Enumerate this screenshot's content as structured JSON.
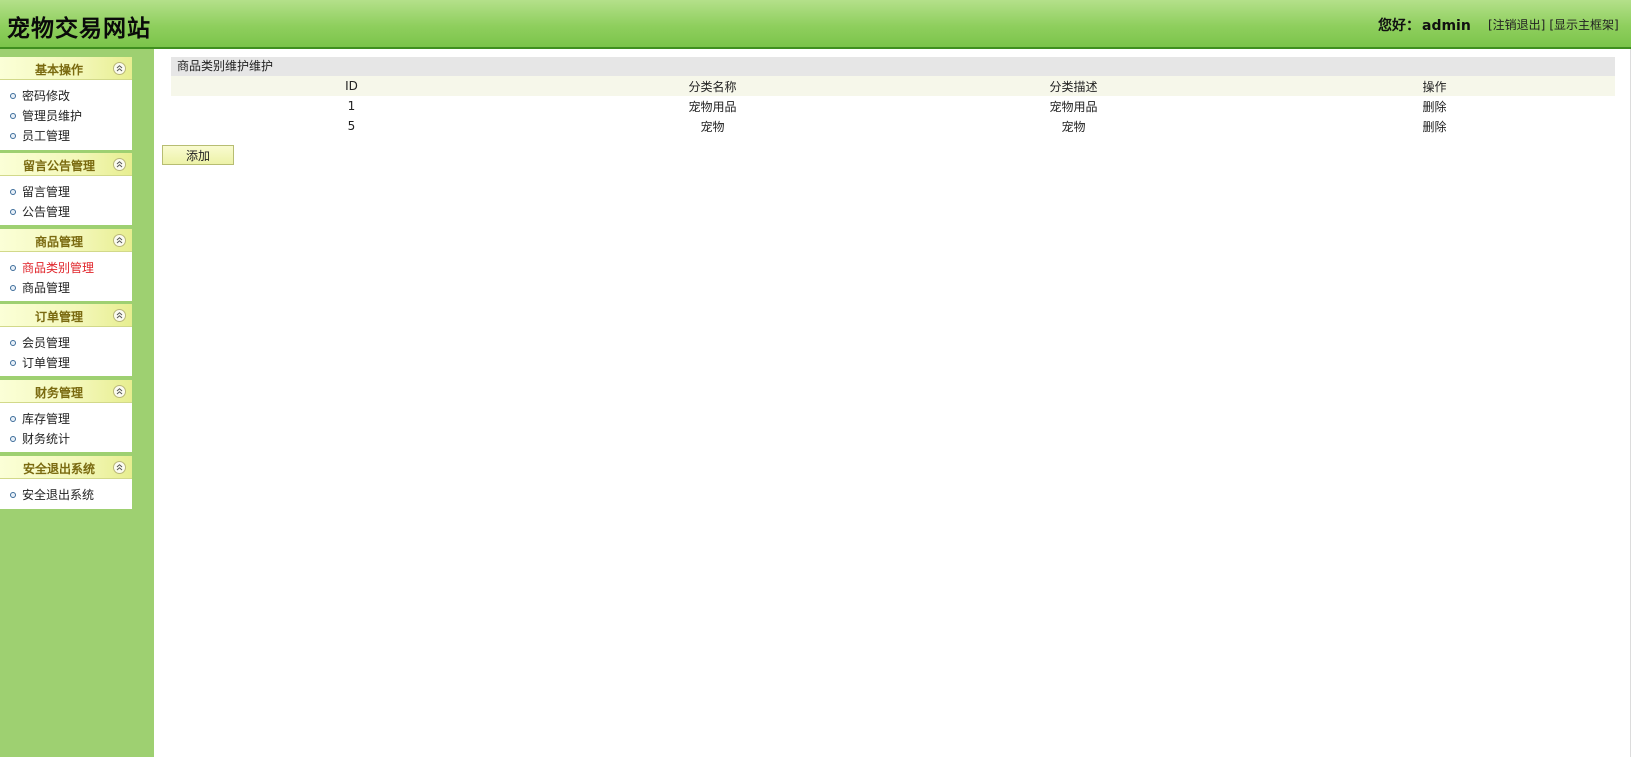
{
  "header": {
    "title": "宠物交易网站",
    "greeting_prefix": "您好：",
    "username": "admin",
    "logout_link": "[注销退出]",
    "main_frame_link": "[显示主框架]"
  },
  "sidebar": {
    "groups": [
      {
        "title": "基本操作",
        "items": [
          {
            "label": "密码修改"
          },
          {
            "label": "管理员维护"
          },
          {
            "label": "员工管理"
          }
        ]
      },
      {
        "title": "留言公告管理",
        "items": [
          {
            "label": "留言管理"
          },
          {
            "label": "公告管理"
          }
        ]
      },
      {
        "title": "商品管理",
        "items": [
          {
            "label": "商品类别管理",
            "active": true
          },
          {
            "label": "商品管理"
          }
        ]
      },
      {
        "title": "订单管理",
        "items": [
          {
            "label": "会员管理"
          },
          {
            "label": "订单管理"
          }
        ]
      },
      {
        "title": "财务管理",
        "items": [
          {
            "label": "库存管理"
          },
          {
            "label": "财务统计"
          }
        ]
      },
      {
        "title": "安全退出系统",
        "items": [
          {
            "label": "安全退出系统"
          }
        ]
      }
    ]
  },
  "main": {
    "panel_title": "商品类别维护维护",
    "columns": [
      "ID",
      "分类名称",
      "分类描述",
      "操作"
    ],
    "rows": [
      {
        "id": "1",
        "name": "宠物用品",
        "desc": "宠物用品",
        "action": "删除"
      },
      {
        "id": "5",
        "name": "宠物",
        "desc": "宠物",
        "action": "删除"
      }
    ],
    "add_button": "添加"
  },
  "colors": {
    "header_green": "#8fcf5e",
    "sidebar_green": "#9ed071",
    "menu_head_yellow": "#f3f7b8",
    "active_item_red": "#e0242a"
  }
}
